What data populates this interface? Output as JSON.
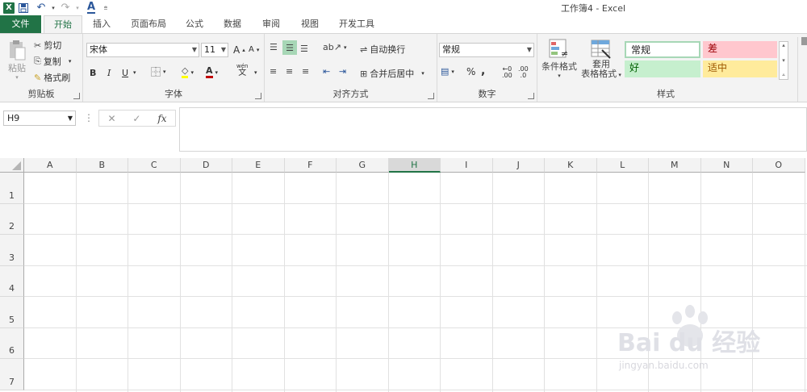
{
  "app": {
    "title": "工作簿4 - Excel",
    "logo": "X"
  },
  "qat": {
    "save_icon": "save-icon",
    "undo_icon": "undo-icon",
    "redo_icon": "redo-icon",
    "font_color_icon": "A"
  },
  "tabs": {
    "file": "文件",
    "home": "开始",
    "insert": "插入",
    "layout": "页面布局",
    "formula": "公式",
    "data": "数据",
    "review": "审阅",
    "view": "视图",
    "dev": "开发工具"
  },
  "clipboard": {
    "paste": "粘贴",
    "cut": "剪切",
    "copy": "复制",
    "painter": "格式刷",
    "label": "剪贴板"
  },
  "font": {
    "name": "宋体",
    "size": "11",
    "bold": "B",
    "italic": "I",
    "underline": "U",
    "grow": "A",
    "shrink": "A",
    "color_a": "A",
    "wen": "wén",
    "label": "字体"
  },
  "align": {
    "wrap": "自动换行",
    "merge": "合并后居中",
    "label": "对齐方式"
  },
  "number": {
    "format": "常规",
    "percent": "%",
    "comma": ",",
    "inc_dec": ".00",
    "dec_dec": ".0",
    "label": "数字"
  },
  "styles": {
    "cond_format": "条件格式",
    "table_format_1": "套用",
    "table_format_2": "表格格式",
    "normal": "常规",
    "bad": "差",
    "good": "好",
    "neutral": "适中",
    "label": "样式"
  },
  "formula_bar": {
    "name_box": "H9",
    "cancel": "✕",
    "enter": "✓",
    "fx": "fx",
    "content": ""
  },
  "sheet": {
    "columns": [
      "A",
      "B",
      "C",
      "D",
      "E",
      "F",
      "G",
      "H",
      "I",
      "J",
      "K",
      "L",
      "M",
      "N",
      "O"
    ],
    "selected_column": "H",
    "rows": [
      "1",
      "2",
      "3",
      "4",
      "5",
      "6",
      "7"
    ]
  },
  "watermark": {
    "text": "Bai du 经验",
    "url": "jingyan.baidu.com"
  },
  "colors": {
    "excel_green": "#217346",
    "bad_bg": "#ffc7ce",
    "bad_fg": "#9c0006",
    "good_bg": "#c6efce",
    "good_fg": "#006100",
    "neutral_bg": "#ffeb9c",
    "neutral_fg": "#9c5700"
  }
}
